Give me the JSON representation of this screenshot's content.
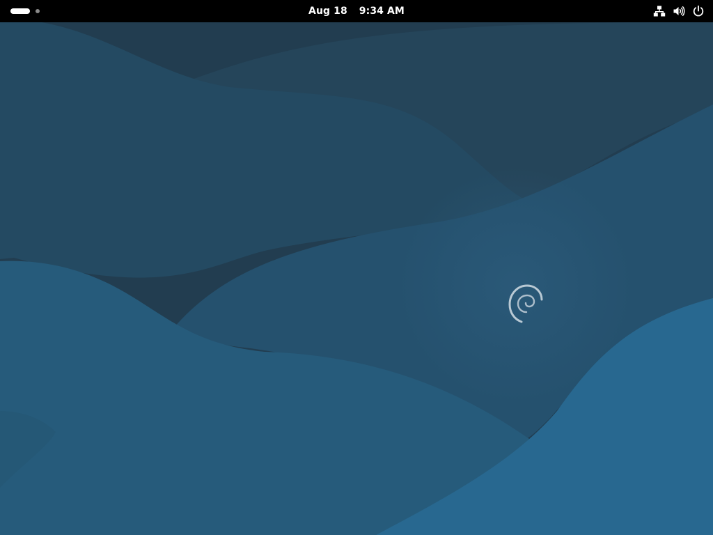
{
  "topbar": {
    "date": "Aug 18",
    "time": "9:34 AM",
    "workspace_indicator": {
      "active": 1,
      "count": 2
    },
    "status_icons": [
      "network-wired-icon",
      "volume-icon",
      "power-icon"
    ]
  },
  "wallpaper": {
    "logo": "debian-swirl-icon",
    "colors": {
      "dark": "#243f54",
      "mid": "#25506c",
      "light": "#275f85",
      "accent": "#286a94"
    }
  }
}
